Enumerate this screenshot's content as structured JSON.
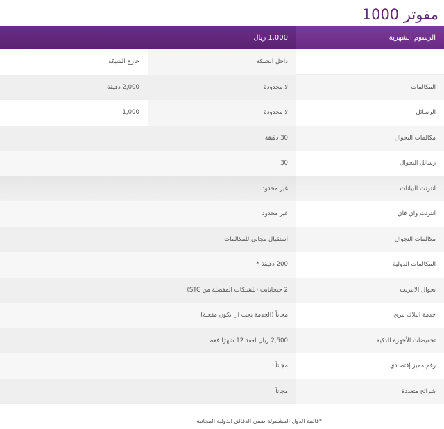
{
  "page": {
    "title": "مفوتر 1000"
  },
  "header": {
    "label": "الرسوم الشهرية",
    "price": "1,000 ريال"
  },
  "rows": [
    {
      "label": "",
      "col1": "داخل الشبكة",
      "col2": "خارج الشبكة"
    },
    {
      "label": "المكالمات",
      "col1": "لا محدودة",
      "col2": "2,000 دقيقة"
    },
    {
      "label": "الرسائل",
      "col1": "لا محدودة",
      "col2": "1,000"
    },
    {
      "label": "مكالمات التجوال",
      "value": "30 دقيقة"
    },
    {
      "label": "رسائل التجوال",
      "value": "30"
    },
    {
      "label": "انترنت البيانات",
      "value": "غير محدود"
    },
    {
      "label": "انترنت واي فاي",
      "value": "غير محدود"
    },
    {
      "label": "مكالمات التجوال",
      "value": "استقبال مجاني للمكالمات"
    },
    {
      "label": "المكالمات الدولية",
      "value": "200 دقيقة *"
    },
    {
      "label": "تجوال الانترنت",
      "value": "2 جيجابايت (للشبكات المفضلة من STC)"
    },
    {
      "label": "خدمة البلاك بيري",
      "value": "مجاناً (الخدمة يجب ان تكون مفعلة)"
    },
    {
      "label": "تخفيضات الأجهزة الذكية",
      "value": "2,500 ريال لعقد 12 شهرًا فقط"
    },
    {
      "label": "رقم مميز إقتصادي",
      "value": "مجاناً"
    },
    {
      "label": "شرائح متعددة",
      "value": "مجاناً"
    }
  ],
  "footnote": "*قائمة الدول المشمولة ضمن الدقائق الدولية المجانية",
  "colors": {
    "header_bg": "#5e2474",
    "title": "#5d2a72",
    "row_alt": "#efefef"
  }
}
